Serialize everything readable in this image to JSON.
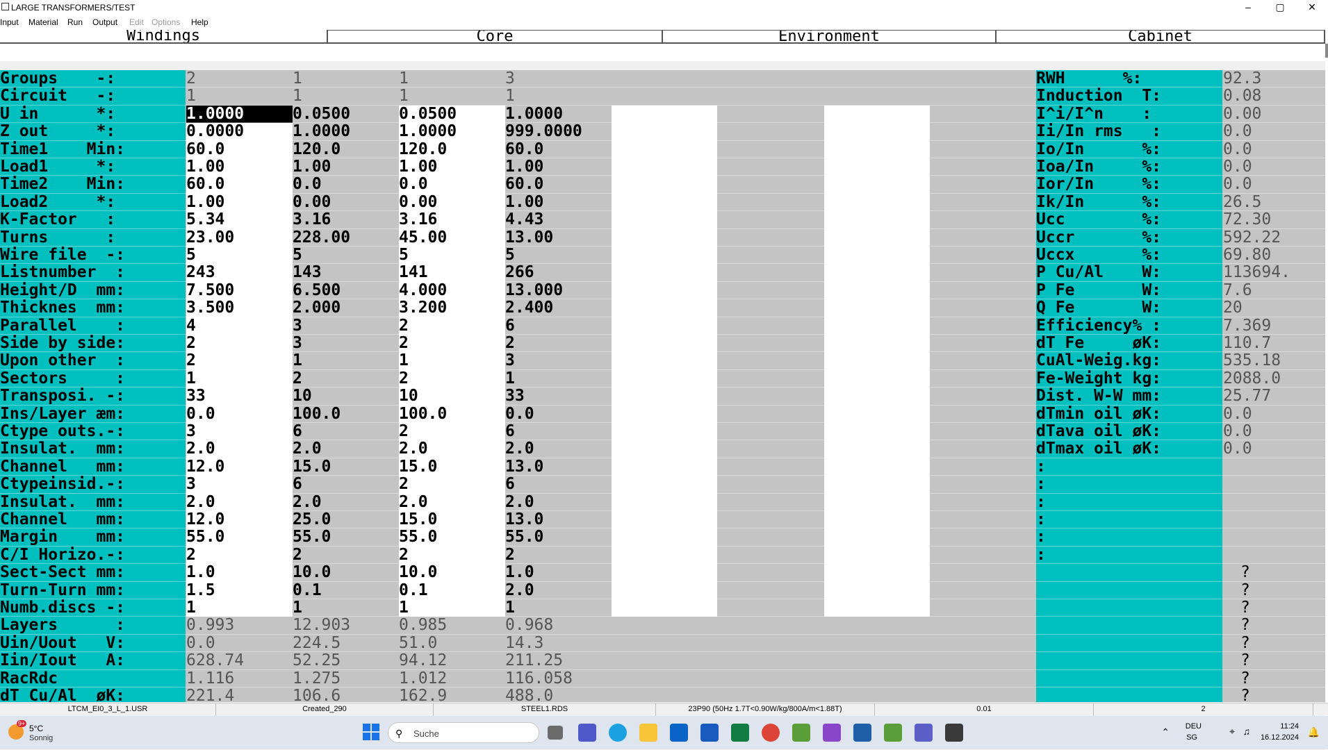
{
  "window": {
    "title": "LARGE TRANSFORMERS/TEST",
    "min": "–",
    "max": "▢",
    "close": "✕"
  },
  "menu": [
    {
      "label": "Input",
      "enabled": true
    },
    {
      "label": "Material",
      "enabled": true
    },
    {
      "label": "Run",
      "enabled": true
    },
    {
      "label": "Output",
      "enabled": true
    },
    {
      "label": "Edit",
      "enabled": false
    },
    {
      "label": "Options",
      "enabled": false
    },
    {
      "label": "Help",
      "enabled": true
    }
  ],
  "tabs": [
    "Windings",
    "Core",
    "Environment",
    "Cabinet"
  ],
  "left_rows": [
    {
      "label": "Groups    -:",
      "values": [
        "2",
        "1",
        "1",
        "3"
      ],
      "type": "dim"
    },
    {
      "label": "Circuit   -:",
      "values": [
        "1",
        "1",
        "1",
        "1"
      ],
      "type": "dim"
    },
    {
      "label": "U in      *:",
      "values": [
        "1.0000",
        "0.0500",
        "0.0500",
        "1.0000"
      ],
      "type": "edit"
    },
    {
      "label": "Z out     *:",
      "values": [
        "0.0000",
        "1.0000",
        "1.0000",
        "999.0000"
      ],
      "type": "edit"
    },
    {
      "label": "Time1    Min:",
      "values": [
        "60.0",
        "120.0",
        "120.0",
        "60.0"
      ],
      "type": "edit"
    },
    {
      "label": "Load1     *:",
      "values": [
        "1.00",
        "1.00",
        "1.00",
        "1.00"
      ],
      "type": "edit"
    },
    {
      "label": "Time2    Min:",
      "values": [
        "60.0",
        "0.0",
        "0.0",
        "60.0"
      ],
      "type": "edit"
    },
    {
      "label": "Load2     *:",
      "values": [
        "1.00",
        "0.00",
        "0.00",
        "1.00"
      ],
      "type": "edit"
    },
    {
      "label": "K-Factor   :",
      "values": [
        "5.34",
        "3.16",
        "3.16",
        "4.43"
      ],
      "type": "edit"
    },
    {
      "label": "Turns      :",
      "values": [
        "23.00",
        "228.00",
        "45.00",
        "13.00"
      ],
      "type": "edit"
    },
    {
      "label": "Wire file  -:",
      "values": [
        "5",
        "5",
        "5",
        "5"
      ],
      "type": "edit"
    },
    {
      "label": "Listnumber  :",
      "values": [
        "243",
        "143",
        "141",
        "266"
      ],
      "type": "edit"
    },
    {
      "label": "Height/D  mm:",
      "values": [
        "7.500",
        "6.500",
        "4.000",
        "13.000"
      ],
      "type": "edit"
    },
    {
      "label": "Thicknes  mm:",
      "values": [
        "3.500",
        "2.000",
        "3.200",
        "2.400"
      ],
      "type": "edit"
    },
    {
      "label": "Parallel    :",
      "values": [
        "4",
        "3",
        "2",
        "6"
      ],
      "type": "edit"
    },
    {
      "label": "Side by side:",
      "values": [
        "2",
        "3",
        "2",
        "2"
      ],
      "type": "edit"
    },
    {
      "label": "Upon other  :",
      "values": [
        "2",
        "1",
        "1",
        "3"
      ],
      "type": "edit"
    },
    {
      "label": "Sectors     :",
      "values": [
        "1",
        "2",
        "2",
        "1"
      ],
      "type": "edit"
    },
    {
      "label": "Transposi. -:",
      "values": [
        "33",
        "10",
        "10",
        "33"
      ],
      "type": "edit"
    },
    {
      "label": "Ins/Layer æm:",
      "values": [
        "0.0",
        "100.0",
        "100.0",
        "0.0"
      ],
      "type": "edit"
    },
    {
      "label": "Ctype outs.-:",
      "values": [
        "3",
        "6",
        "2",
        "6"
      ],
      "type": "edit"
    },
    {
      "label": "Insulat.  mm:",
      "values": [
        "2.0",
        "2.0",
        "2.0",
        "2.0"
      ],
      "type": "edit"
    },
    {
      "label": "Channel   mm:",
      "values": [
        "12.0",
        "15.0",
        "15.0",
        "13.0"
      ],
      "type": "edit"
    },
    {
      "label": "Ctypeinsid.-:",
      "values": [
        "3",
        "6",
        "2",
        "6"
      ],
      "type": "edit"
    },
    {
      "label": "Insulat.  mm:",
      "values": [
        "2.0",
        "2.0",
        "2.0",
        "2.0"
      ],
      "type": "edit"
    },
    {
      "label": "Channel   mm:",
      "values": [
        "12.0",
        "25.0",
        "15.0",
        "13.0"
      ],
      "type": "edit"
    },
    {
      "label": "Margin    mm:",
      "values": [
        "55.0",
        "55.0",
        "55.0",
        "55.0"
      ],
      "type": "edit"
    },
    {
      "label": "C/I Horizo.-:",
      "values": [
        "2",
        "2",
        "2",
        "2"
      ],
      "type": "edit"
    },
    {
      "label": "Sect-Sect mm:",
      "values": [
        "1.0",
        "10.0",
        "10.0",
        "1.0"
      ],
      "type": "edit"
    },
    {
      "label": "Turn-Turn mm:",
      "values": [
        "1.5",
        "0.1",
        "0.1",
        "2.0"
      ],
      "type": "edit"
    },
    {
      "label": "Numb.discs -:",
      "values": [
        "1",
        "1",
        "1",
        "1"
      ],
      "type": "edit"
    },
    {
      "label": "Layers      :",
      "values": [
        "0.993",
        "12.903",
        "0.985",
        "0.968"
      ],
      "type": "dim"
    },
    {
      "label": "Uin/Uout   V:",
      "values": [
        "0.0",
        "224.5",
        "51.0",
        "14.3"
      ],
      "type": "dim"
    },
    {
      "label": "Iin/Iout   A:",
      "values": [
        "628.74",
        "52.25",
        "94.12",
        "211.25"
      ],
      "type": "dim"
    },
    {
      "label": "RacRdc      ",
      "values": [
        "1.116",
        "1.275",
        "1.012",
        "116.058"
      ],
      "type": "dim"
    },
    {
      "label": "dT Cu/Al  øK:",
      "values": [
        "221.4",
        "106.6",
        "162.9",
        "488.0"
      ],
      "type": "dim"
    }
  ],
  "right_rows": [
    {
      "label": "RWH      %:",
      "value": "92.3"
    },
    {
      "label": "Induction  T:",
      "value": "0.08"
    },
    {
      "label": "I^i/I^n    :",
      "value": "0.00"
    },
    {
      "label": "Ii/In rms   :",
      "value": "0.0"
    },
    {
      "label": "Io/In      %:",
      "value": "0.0"
    },
    {
      "label": "Ioa/In     %:",
      "value": "0.0"
    },
    {
      "label": "Ior/In     %:",
      "value": "0.0"
    },
    {
      "label": "Ik/In      %:",
      "value": "26.5"
    },
    {
      "label": "Ucc        %:",
      "value": "72.30"
    },
    {
      "label": "Uccr       %:",
      "value": "592.22"
    },
    {
      "label": "Uccx       %:",
      "value": "69.80"
    },
    {
      "label": "P Cu/Al    W:",
      "value": "113694."
    },
    {
      "label": "P Fe       W:",
      "value": "7.6"
    },
    {
      "label": "Q Fe       W:",
      "value": "20"
    },
    {
      "label": "Efficiency% :",
      "value": "7.369"
    },
    {
      "label": "dT Fe     øK:",
      "value": "110.7"
    },
    {
      "label": "CuAl-Weig.kg:",
      "value": "535.18"
    },
    {
      "label": "Fe-Weight kg:",
      "value": "2088.0"
    },
    {
      "label": "Dist. W-W mm:",
      "value": "25.77"
    },
    {
      "label": "dTmin oil øK:",
      "value": "0.0"
    },
    {
      "label": "dTava oil øK:",
      "value": "0.0"
    },
    {
      "label": "dTmax oil øK:",
      "value": "0.0"
    },
    {
      "label": ":",
      "value": ""
    },
    {
      "label": ":",
      "value": ""
    },
    {
      "label": ":",
      "value": ""
    },
    {
      "label": ":",
      "value": ""
    },
    {
      "label": ":",
      "value": ""
    },
    {
      "label": ":",
      "value": ""
    },
    {
      "label": "",
      "value": "?"
    },
    {
      "label": "",
      "value": "?"
    },
    {
      "label": "",
      "value": "?"
    },
    {
      "label": "",
      "value": "?"
    },
    {
      "label": "",
      "value": "?"
    },
    {
      "label": "",
      "value": "?"
    },
    {
      "label": "",
      "value": "?"
    },
    {
      "label": "",
      "value": "?"
    }
  ],
  "status": [
    "LTCM_EI0_3_L_1.USR",
    "Created_290",
    "STEEL1.RDS",
    "23P90 (50Hz 1.7T<0.90W/kg/800A/m<1.88T)",
    "0.01",
    "2"
  ],
  "taskbar": {
    "weather_temp": "5°C",
    "weather_text": "Sonnig",
    "weather_badge": "9+",
    "search_placeholder": "Suche",
    "lang1": "DEU",
    "lang2": "SG",
    "time": "11:24",
    "date": "16.12.2024"
  },
  "colors": {
    "label_bg": "#00bfbf",
    "grid_bg": "#c4c4c4",
    "edit_bg": "#ffffff",
    "selected": "#000000"
  }
}
